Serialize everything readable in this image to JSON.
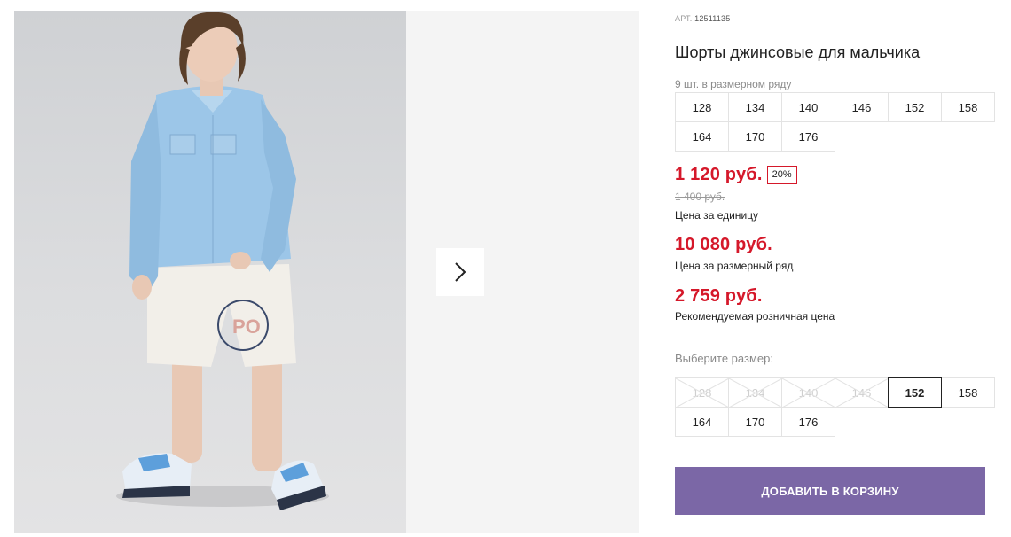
{
  "product": {
    "article_label": "АРТ.",
    "article_number": "12511135",
    "title": "Шорты джинсовые для мальчика",
    "range_caption": "9 шт. в размерном ряду",
    "range_sizes": [
      "128",
      "134",
      "140",
      "146",
      "152",
      "158",
      "164",
      "170",
      "176"
    ]
  },
  "prices": {
    "unit_price": "1 120 руб.",
    "discount_badge": "20%",
    "old_price": "1 400 руб.",
    "unit_label": "Цена за единицу",
    "range_price": "10 080 руб.",
    "range_label": "Цена за размерный ряд",
    "retail_price": "2 759 руб.",
    "retail_label": "Рекомендуемая розничная цена"
  },
  "size_select": {
    "caption": "Выберите размер:",
    "options": [
      {
        "label": "128",
        "available": false
      },
      {
        "label": "134",
        "available": false
      },
      {
        "label": "140",
        "available": false
      },
      {
        "label": "146",
        "available": false
      },
      {
        "label": "152",
        "available": true,
        "selected": true
      },
      {
        "label": "158",
        "available": true
      },
      {
        "label": "164",
        "available": true
      },
      {
        "label": "170",
        "available": true
      },
      {
        "label": "176",
        "available": true
      }
    ]
  },
  "cart": {
    "add_label": "ДОБАВИТЬ В КОРЗИНУ"
  },
  "gallery": {
    "next_icon": "chevron-right-icon"
  },
  "colors": {
    "price_red": "#d5182a",
    "button_purple": "#7b67a6"
  }
}
